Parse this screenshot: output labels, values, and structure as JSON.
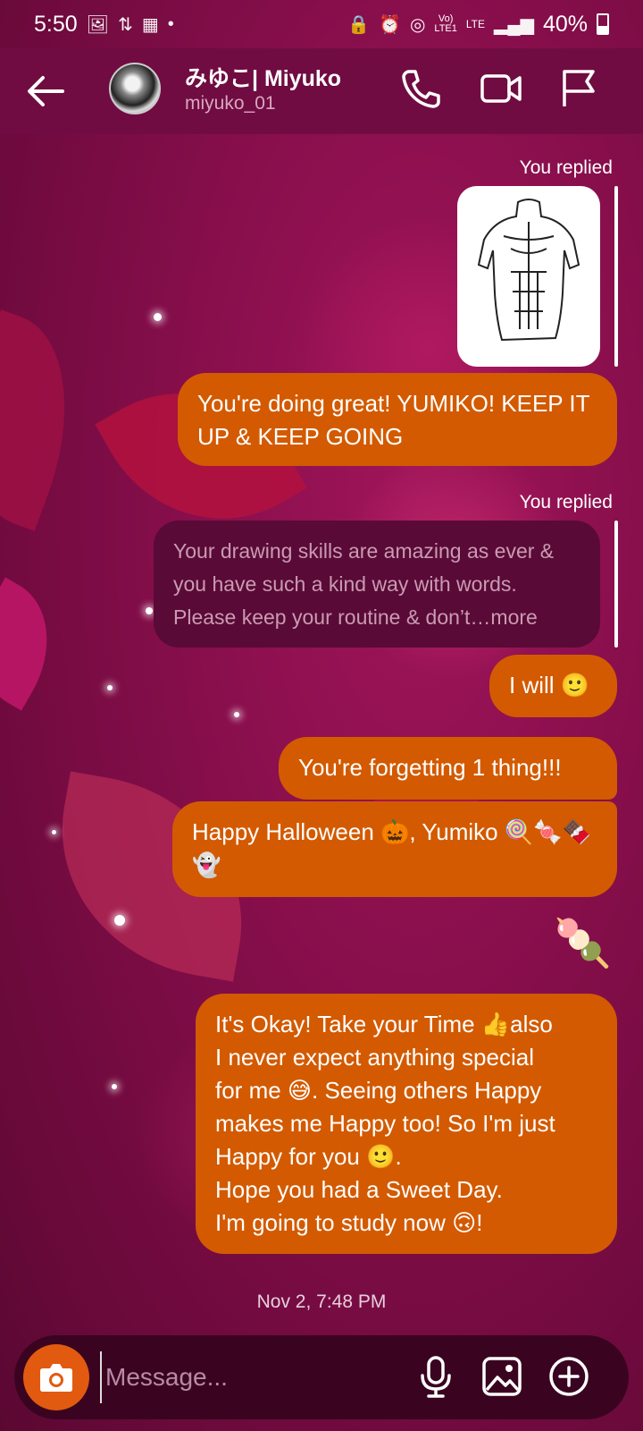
{
  "status_bar": {
    "time": "5:50",
    "battery": "40%",
    "network_top": "Vo)",
    "network_bottom": "LTE1",
    "lte_label": "LTE"
  },
  "header": {
    "display_name": "みゆこ| Miyuko",
    "username": "miyuko_01"
  },
  "messages": {
    "reply_label_1": "You replied",
    "reply_label_2": "You replied",
    "msg_1": "You're doing great! YUMIKO! KEEP IT UP & KEEP GOING",
    "quoted_1": "Your drawing skills are amazing as ever & you have such a kind way with words. Please keep your routine & don’t…more",
    "msg_2": "I will 🙂",
    "msg_3": "You're forgetting 1 thing!!!",
    "msg_4": "Happy Halloween 🎃, Yumiko 🍭🍬🍫👻",
    "sticker": "🍡",
    "msg_5_lines": [
      "It's Okay! Take your Time 👍also",
      "I never expect anything special",
      "for me 😅. Seeing others Happy",
      "makes me Happy too! So I'm just",
      "Happy for you 🙂.",
      "Hope you had a Sweet Day.",
      "I'm going to study now 🙃!"
    ],
    "timestamp": "Nov 2, 7:48 PM"
  },
  "composer": {
    "placeholder": "Message..."
  },
  "colors": {
    "bubble": "#d35a00",
    "background": "#7b0d45",
    "header": "#700c41",
    "camera_button": "#e25a0f"
  },
  "icons": [
    "back-arrow-icon",
    "phone-icon",
    "video-camera-icon",
    "flag-icon",
    "camera-icon",
    "microphone-icon",
    "gallery-icon",
    "plus-circle-icon"
  ]
}
